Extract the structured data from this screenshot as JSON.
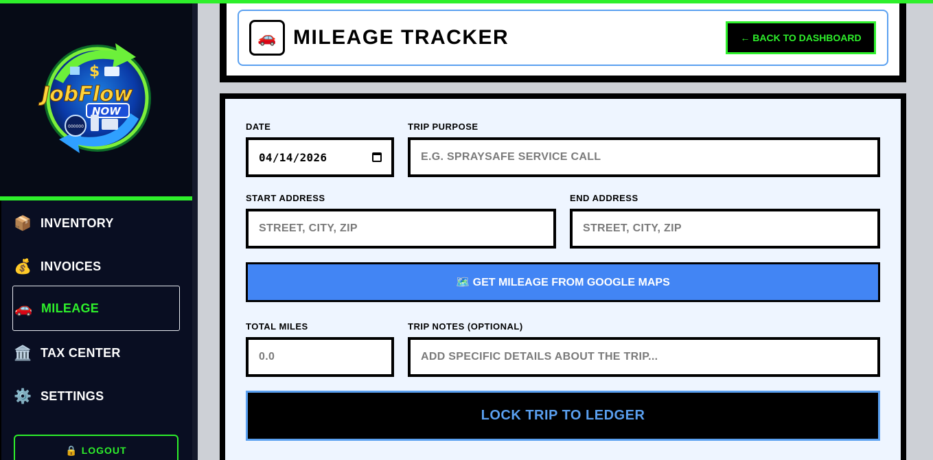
{
  "brand": {
    "logo_line1": "JobFlow",
    "logo_line2": "NOW",
    "logo_odometer": "000000"
  },
  "sidebar": {
    "items": [
      {
        "label": "INVENTORY",
        "icon": "📦",
        "icon_name": "package-icon"
      },
      {
        "label": "INVOICES",
        "icon": "💰",
        "icon_name": "money-bag-icon"
      },
      {
        "label": "MILEAGE",
        "icon": "🚗",
        "icon_name": "car-icon",
        "active": true
      },
      {
        "label": "TAX CENTER",
        "icon": "🏛️",
        "icon_name": "bank-icon"
      },
      {
        "label": "SETTINGS",
        "icon": "⚙️",
        "icon_name": "gear-icon"
      }
    ],
    "logout_label": "🔒 LOGOUT"
  },
  "header": {
    "icon": "🚗",
    "title": "MILEAGE TRACKER",
    "back_label": "← BACK TO DASHBOARD"
  },
  "form": {
    "date_label": "DATE",
    "date_value": "04/14/2026",
    "purpose_label": "TRIP PURPOSE",
    "purpose_placeholder": "E.G. SPRAYSAFE SERVICE CALL",
    "start_label": "START ADDRESS",
    "start_placeholder": "STREET, CITY, ZIP",
    "end_label": "END ADDRESS",
    "end_placeholder": "STREET, CITY, ZIP",
    "maps_button": "🗺️ GET MILEAGE FROM GOOGLE MAPS",
    "miles_label": "TOTAL MILES",
    "miles_placeholder": "0.0",
    "notes_label": "TRIP NOTES (OPTIONAL)",
    "notes_placeholder": "ADD SPECIFIC DETAILS ABOUT THE TRIP...",
    "submit_label": "LOCK TRIP TO LEDGER"
  },
  "colors": {
    "accent_green": "#2ef02b",
    "accent_blue": "#5aa0f0",
    "maps_blue": "#4285f4",
    "sidebar_bg": "#090e22"
  }
}
